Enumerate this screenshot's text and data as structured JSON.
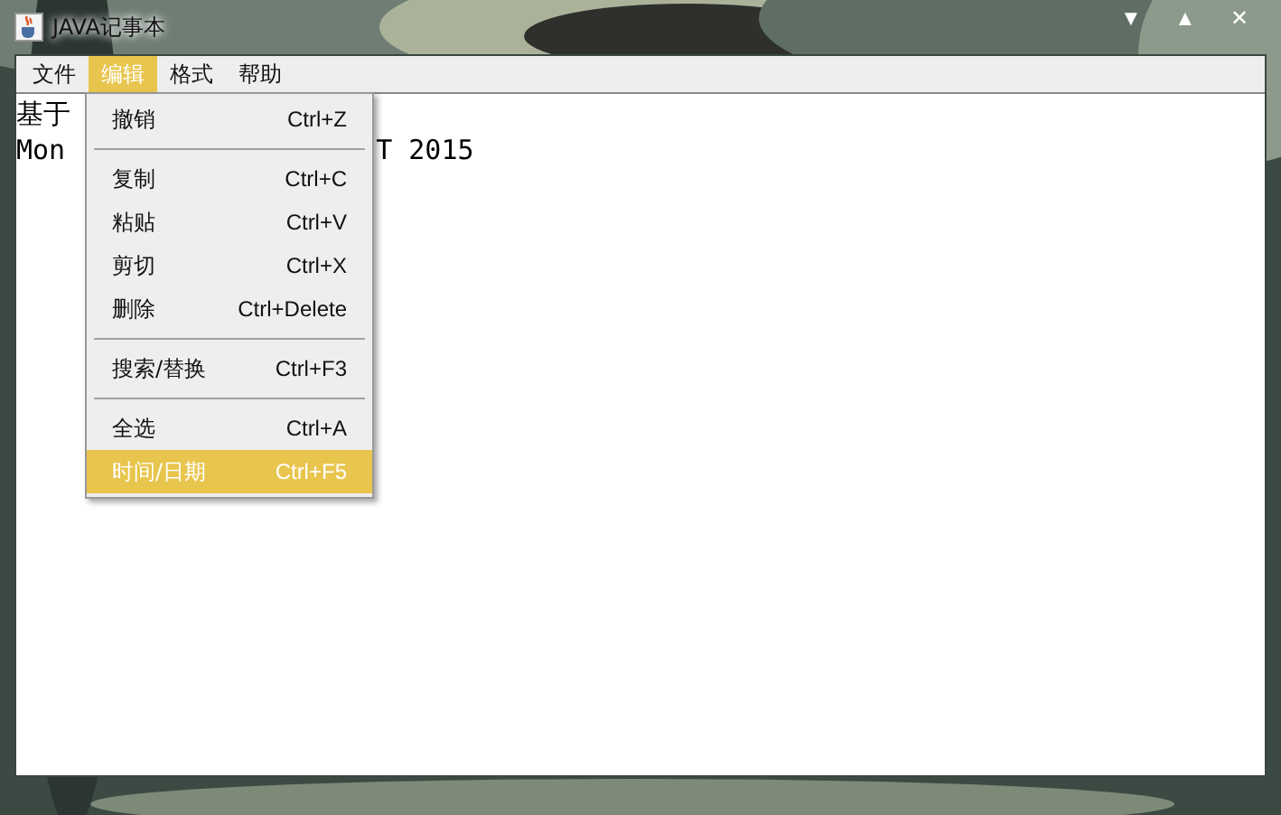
{
  "window": {
    "title": "JAVA记事本",
    "controls": [
      "▼",
      "▲",
      "✕"
    ]
  },
  "menubar": [
    {
      "label": "文件",
      "selected": false
    },
    {
      "label": "编辑",
      "selected": true
    },
    {
      "label": "格式",
      "selected": false
    },
    {
      "label": "帮助",
      "selected": false
    }
  ],
  "editor": {
    "lines": [
      {
        "text": "基于"
      },
      {
        "text": "Mon",
        "hidden_tail": "T 2015"
      }
    ]
  },
  "menu": {
    "items": [
      {
        "kind": "item",
        "label": "撤销",
        "shortcut": "Ctrl+Z",
        "selected": false
      },
      {
        "kind": "separator"
      },
      {
        "kind": "item",
        "label": "复制",
        "shortcut": "Ctrl+C",
        "selected": false
      },
      {
        "kind": "item",
        "label": "粘贴",
        "shortcut": "Ctrl+V",
        "selected": false
      },
      {
        "kind": "item",
        "label": "剪切",
        "shortcut": "Ctrl+X",
        "selected": false
      },
      {
        "kind": "item",
        "label": "删除",
        "shortcut": "Ctrl+Delete",
        "selected": false
      },
      {
        "kind": "separator"
      },
      {
        "kind": "item",
        "label": "搜索/替换",
        "shortcut": "Ctrl+F3",
        "selected": false
      },
      {
        "kind": "separator"
      },
      {
        "kind": "item",
        "label": "全选",
        "shortcut": "Ctrl+A",
        "selected": false
      },
      {
        "kind": "item",
        "label": "时间/日期",
        "shortcut": "Ctrl+F5",
        "selected": true
      }
    ]
  }
}
